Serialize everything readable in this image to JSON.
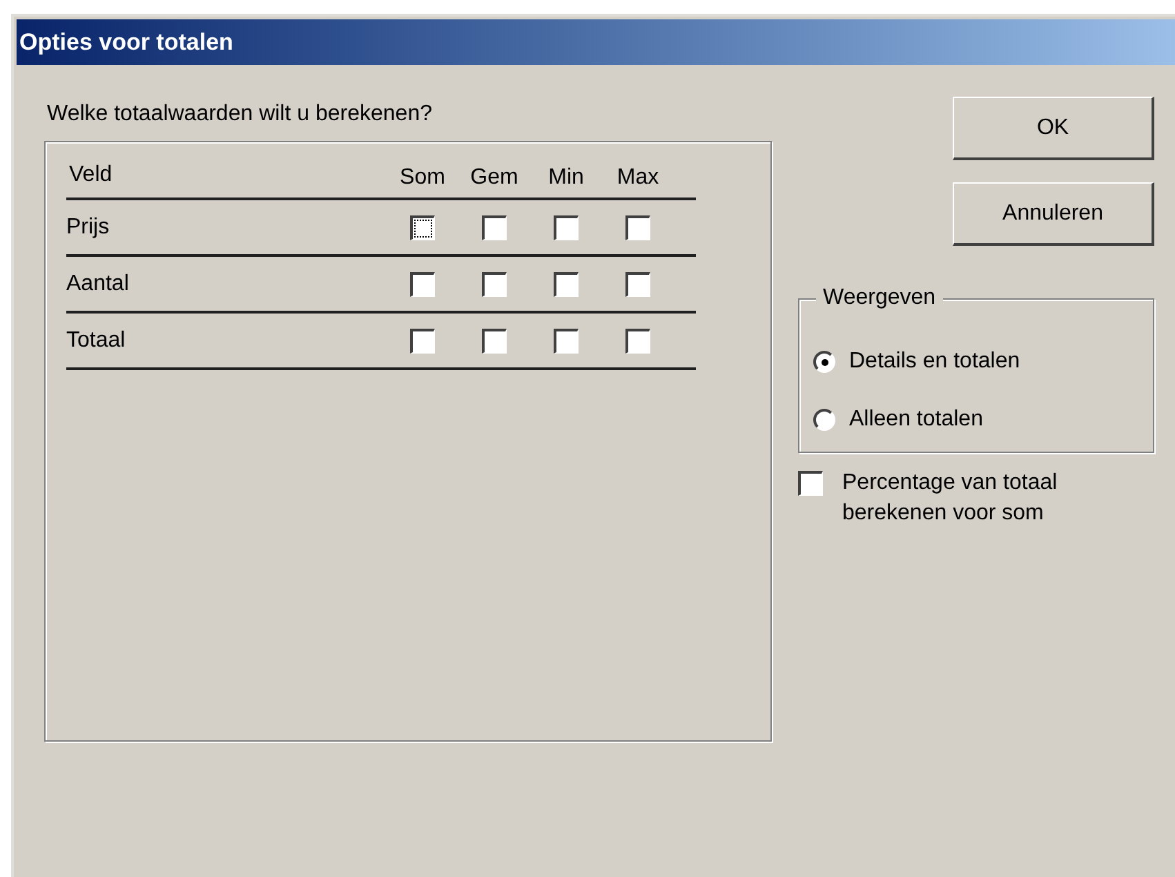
{
  "window": {
    "title": "Opties voor totalen"
  },
  "prompt": "Welke totaalwaarden wilt u berekenen?",
  "table": {
    "columns": [
      "Veld",
      "Som",
      "Gem",
      "Min",
      "Max"
    ],
    "rows": [
      {
        "field": "Prijs",
        "checks": [
          {
            "checked": false,
            "focused": true
          },
          {
            "checked": false,
            "focused": false
          },
          {
            "checked": false,
            "focused": false
          },
          {
            "checked": false,
            "focused": false
          }
        ]
      },
      {
        "field": "Aantal",
        "checks": [
          {
            "checked": false,
            "focused": false
          },
          {
            "checked": false,
            "focused": false
          },
          {
            "checked": false,
            "focused": false
          },
          {
            "checked": false,
            "focused": false
          }
        ]
      },
      {
        "field": "Totaal",
        "checks": [
          {
            "checked": false,
            "focused": false
          },
          {
            "checked": false,
            "focused": false
          },
          {
            "checked": false,
            "focused": false
          },
          {
            "checked": false,
            "focused": false
          }
        ]
      }
    ]
  },
  "buttons": [
    "OK",
    "Annuleren"
  ],
  "display_group": {
    "title": "Weergeven",
    "options": [
      {
        "label": "Details en totalen",
        "selected": true
      },
      {
        "label": "Alleen totalen",
        "selected": false
      }
    ]
  },
  "percentage": {
    "label": "Percentage van totaal berekenen voor som",
    "checked": false
  }
}
